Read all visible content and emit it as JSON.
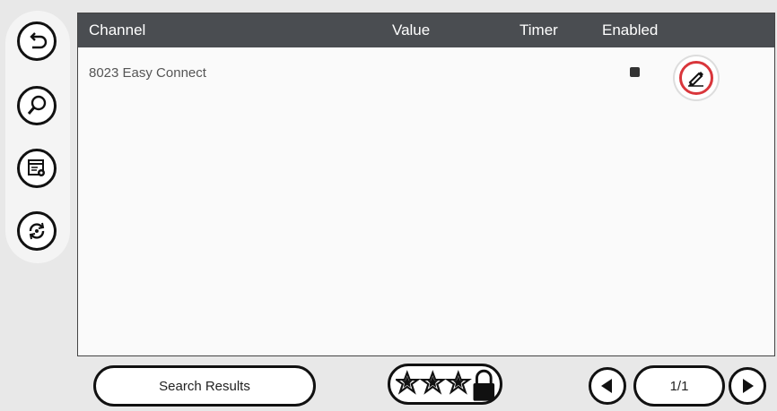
{
  "table": {
    "headers": {
      "channel": "Channel",
      "value": "Value",
      "timer": "Timer",
      "enabled": "Enabled"
    },
    "rows": [
      {
        "channel": "8023 Easy Connect",
        "value": "",
        "timer": "",
        "enabled": true
      }
    ]
  },
  "sidebar": {
    "items": [
      {
        "icon": "back-arrow-icon"
      },
      {
        "icon": "search-icon"
      },
      {
        "icon": "settings-document-icon"
      },
      {
        "icon": "refresh-icon"
      }
    ]
  },
  "footer": {
    "search_results_label": "Search Results",
    "page_indicator": "1/1",
    "favorites_icon": "three-stars-lock-icon"
  },
  "colors": {
    "header_bg": "#4a4d51",
    "highlight_ring": "#d9363b"
  }
}
